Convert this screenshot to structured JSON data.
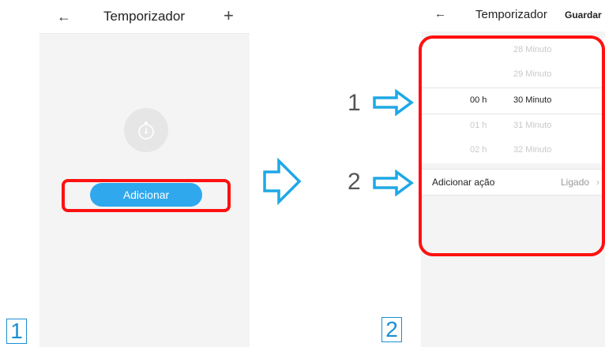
{
  "screen1": {
    "title": "Temporizador",
    "back_icon": "arrow-left-icon",
    "add_icon": "plus-icon",
    "timer_icon": "stopwatch-icon",
    "add_button_label": "Adicionar"
  },
  "screen2": {
    "title": "Temporizador",
    "back_icon": "arrow-left-icon",
    "save_label": "Guardar",
    "picker": {
      "rows": [
        {
          "hour": "",
          "minute": "28 Minuto"
        },
        {
          "hour": "",
          "minute": "29 Minuto"
        },
        {
          "hour": "00 h",
          "minute": "30 Minuto"
        },
        {
          "hour": "01 h",
          "minute": "31 Minuto"
        },
        {
          "hour": "02 h",
          "minute": "32 Minuto"
        }
      ]
    },
    "action_row": {
      "label": "Adicionar ação",
      "value": "Ligado",
      "chevron_icon": "chevron-right-icon"
    }
  },
  "annotations": {
    "step1": "1",
    "step2": "2",
    "arrow1_label": "1",
    "arrow2_label": "2"
  },
  "colors": {
    "accent": "#2fa8ee",
    "highlight": "#ff1010",
    "arrow": "#1ea8e6"
  }
}
